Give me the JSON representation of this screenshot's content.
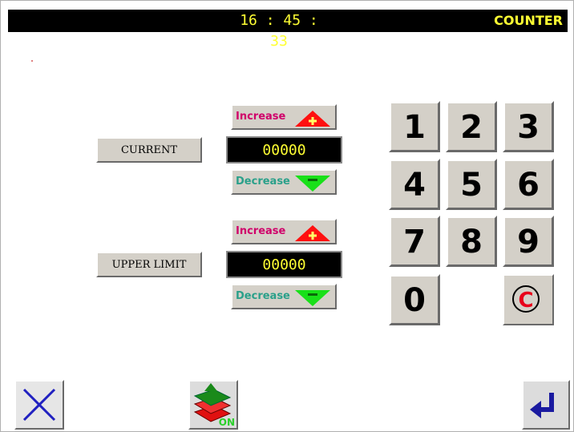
{
  "header": {
    "time": "16 : 45 : 33",
    "mode_title": "COUNTER"
  },
  "current": {
    "label": "CURRENT",
    "value": "00000",
    "increase_label": "Increase",
    "decrease_label": "Decrease"
  },
  "upper_limit": {
    "label": "UPPER LIMIT",
    "value": "00000",
    "increase_label": "Increase",
    "decrease_label": "Decrease"
  },
  "keypad": {
    "keys": [
      "1",
      "2",
      "3",
      "4",
      "5",
      "6",
      "7",
      "8",
      "9",
      "0"
    ],
    "clear_key": "C"
  },
  "footer": {
    "on_text": "ON"
  },
  "colors": {
    "increase_arrow": "#ff1010",
    "decrease_arrow": "#19e019",
    "value_text": "#ffff33",
    "header_text": "#ffff33",
    "clear_key": "#e8001a"
  },
  "icons": {
    "cancel": "close-icon",
    "layers": "layers-on-icon",
    "enter": "enter-icon"
  }
}
